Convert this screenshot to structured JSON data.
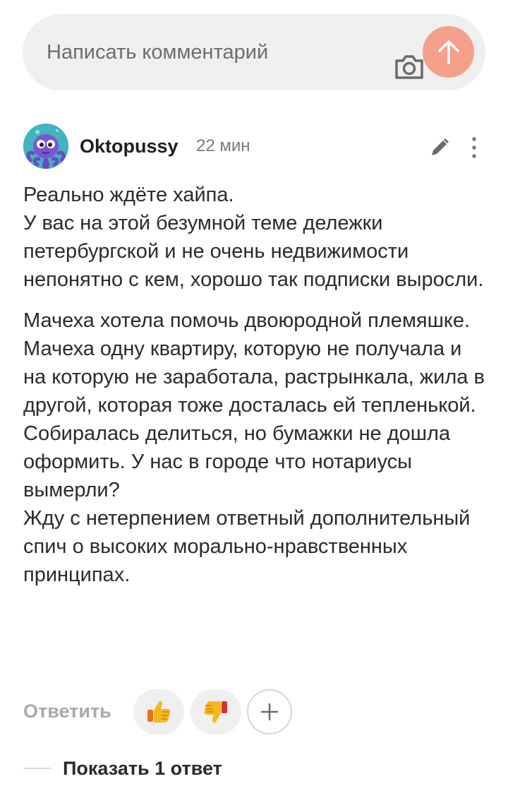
{
  "composer": {
    "placeholder": "Написать комментарий",
    "camera_icon": "camera-icon",
    "send_icon": "arrow-up-icon",
    "send_color": "#f4a08a"
  },
  "comment": {
    "author": "Oktopussy",
    "time": "22 мин",
    "avatar_icon": "octopus-avatar",
    "paragraphs": [
      "Реально ждёте хайпа.\nУ вас на этой безумной теме дележки петербургской и не очень недвижимости непонятно с кем, хорошо так подписки выросли.",
      "Мачеха хотела помочь двоюродной племяшке.\nМачеха одну квартиру, которую не получала и на которую не заработала, растрынкала, жила в другой, которая тоже досталась ей тепленькой.\nСобиралась делиться, но бумажки не дошла оформить. У нас в городе что нотариусы вымерли?\nЖду с нетерпением ответный дополнительный спич о высоких морально-нравственных принципах."
    ]
  },
  "actions": {
    "reply_label": "Ответить",
    "like_icon": "thumbs-up-icon",
    "dislike_icon": "thumbs-down-icon",
    "add_reaction_icon": "plus-icon"
  },
  "replies": {
    "show_label": "Показать 1 ответ"
  }
}
